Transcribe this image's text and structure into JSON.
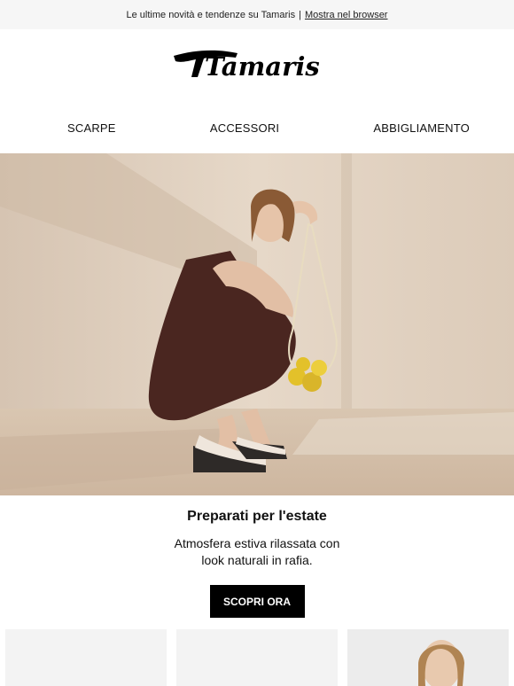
{
  "topbar": {
    "text": "Le ultime novità e tendenze su Tamaris",
    "separator": "|",
    "link_label": "Mostra nel browser"
  },
  "brand": {
    "logo_text": "Tamaris"
  },
  "nav": {
    "items": [
      {
        "label": "SCARPE"
      },
      {
        "label": "ACCESSORI"
      },
      {
        "label": "ABBIGLIAMENTO"
      }
    ]
  },
  "hero": {
    "image": "woman-crouching-in-sandals-with-net-bag-of-lemons"
  },
  "promo": {
    "headline": "Preparati per l'estate",
    "line1": "Atmosfera estiva rilassata con",
    "line2": "look naturali in rafia.",
    "cta_label": "SCOPRI ORA"
  },
  "colors": {
    "topbar_bg": "#f6f6f6",
    "cta_bg": "#000000",
    "hero_wall": "#e1d2c2"
  }
}
